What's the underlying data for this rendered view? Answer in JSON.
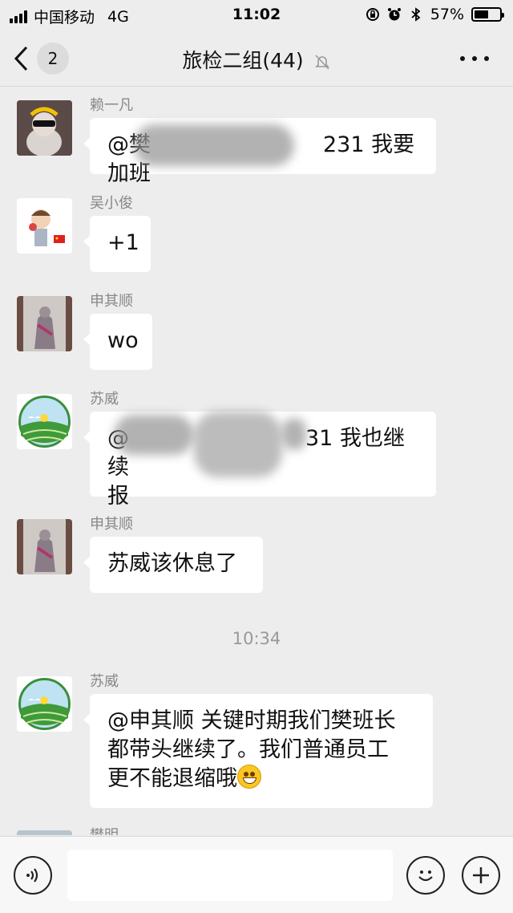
{
  "status_bar": {
    "carrier": "中国移动",
    "network": "4G",
    "time": "11:02",
    "battery": "57%",
    "battery_level": 0.57
  },
  "nav": {
    "back_count": "2",
    "title": "旅检二组(44)"
  },
  "messages": [
    {
      "sender": "赖一凡",
      "text_visible": "@樊",
      "text_tail": "231 我要加班"
    },
    {
      "sender": "吴小俊",
      "text": "+1"
    },
    {
      "sender": "申其顺",
      "text": "wo"
    },
    {
      "sender": "苏威",
      "text_line1_head": "@",
      "text_line1_tail": "31 我也继续",
      "text_line2": "报"
    },
    {
      "sender": "申其顺",
      "text": "苏威该休息了"
    },
    {
      "sender": "苏威",
      "lines": [
        "@申其顺 关键时期我们樊班长",
        "都带头继续了。我们普通员工",
        "更不能退缩哦"
      ]
    },
    {
      "sender": "樊明"
    }
  ],
  "timestamp": "10:34",
  "icons": {
    "back": "chevron-left-icon",
    "mute": "bell-off-icon",
    "more": "more-dots-icon",
    "voice": "voice-icon",
    "emoji": "emoji-icon",
    "plus": "plus-icon"
  },
  "colors": {
    "background": "#ededed",
    "bubble": "#ffffff",
    "sender": "#888888"
  }
}
